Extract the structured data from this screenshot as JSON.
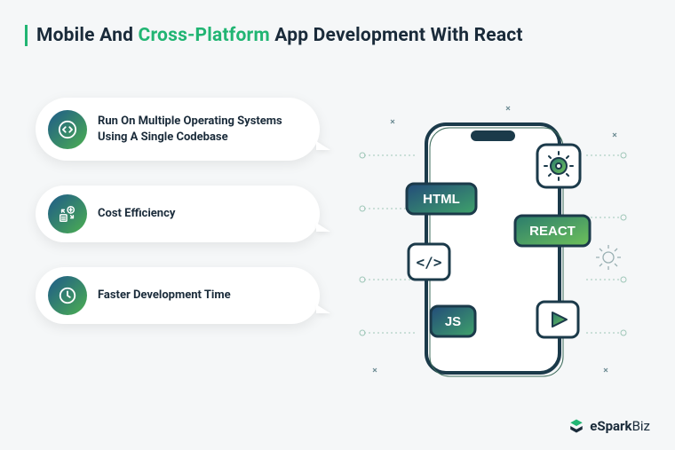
{
  "title": {
    "prefix": "Mobile And ",
    "highlight": "Cross-Platform",
    "suffix": " App Development With React"
  },
  "cards": [
    {
      "icon": "code-icon",
      "text": "Run On Multiple Operating Systems Using A Single Codebase"
    },
    {
      "icon": "cost-icon",
      "text": "Cost Efficiency"
    },
    {
      "icon": "clock-icon",
      "text": "Faster Development Time"
    }
  ],
  "illustration": {
    "badges": [
      "HTML",
      "REACT",
      "JS"
    ]
  },
  "brand": {
    "name": "eSpark",
    "suffix": "Biz"
  },
  "colors": {
    "accent": "#21b573",
    "dark": "#1a2b3a",
    "grad_start": "#1e5a8a",
    "grad_end": "#4caf50"
  }
}
